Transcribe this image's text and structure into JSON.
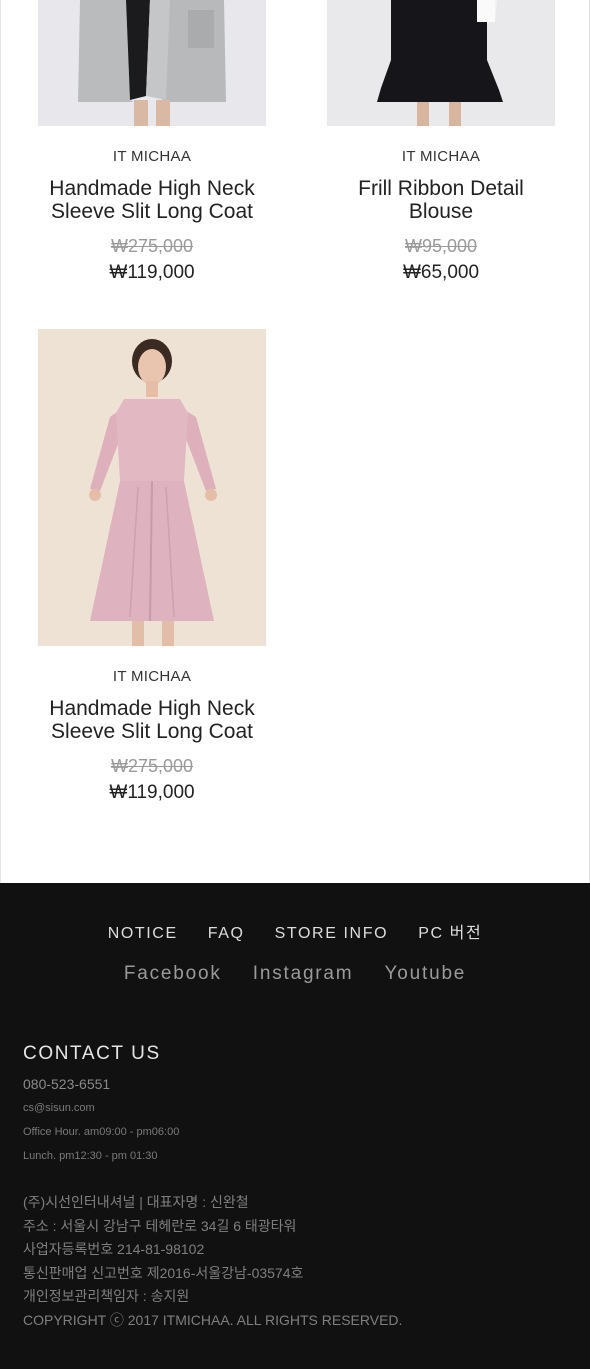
{
  "products": [
    {
      "brand": "IT MICHAA",
      "name_line1": "Handmade High Neck",
      "name_line2": "Sleeve Slit Long Coat",
      "original_price": "₩275,000",
      "sale_price": "₩119,000",
      "image_icon": "coat-photo"
    },
    {
      "brand": "IT MICHAA",
      "name_line1": "Frill Ribbon Detail",
      "name_line2": "Blouse",
      "original_price": "₩95,000",
      "sale_price": "₩65,000",
      "image_icon": "blouse-photo"
    },
    {
      "brand": "IT MICHAA",
      "name_line1": "Handmade High Neck",
      "name_line2": "Sleeve Slit Long Coat",
      "original_price": "₩275,000",
      "sale_price": "₩119,000",
      "image_icon": "dress-photo"
    }
  ],
  "footer": {
    "nav": [
      "NOTICE",
      "FAQ",
      "STORE INFO",
      "PC 버전"
    ],
    "social": [
      "Facebook",
      "Instagram",
      "Youtube"
    ],
    "contact_title": "CONTACT US",
    "phone": "080-523-6551",
    "email": "cs@sisun.com",
    "office_hour": "Office Hour. am09:00 - pm06:00",
    "lunch": "Lunch. pm12:30 - pm 01:30",
    "company": "(주)시선인터내셔널 | 대표자명 : 신완철",
    "address": "주소 : 서울시 강남구 테헤란로 34길 6 태광타워",
    "business_no": "사업자등록번호 214-81-98102",
    "mail_order_no": "통신판매업 신고번호 제2016-서울강남-03574호",
    "privacy_officer": "개인정보관리책임자 : 송지원",
    "copyright": "COPYRIGHT ⓒ 2017 ITMICHAA. ALL RIGHTS RESERVED."
  },
  "colors": {
    "footer_bg": "#111111",
    "content_bg": "#ffffff",
    "dress_pink": "#e2b9c3",
    "backdrop_beige": "#ede1d3"
  }
}
